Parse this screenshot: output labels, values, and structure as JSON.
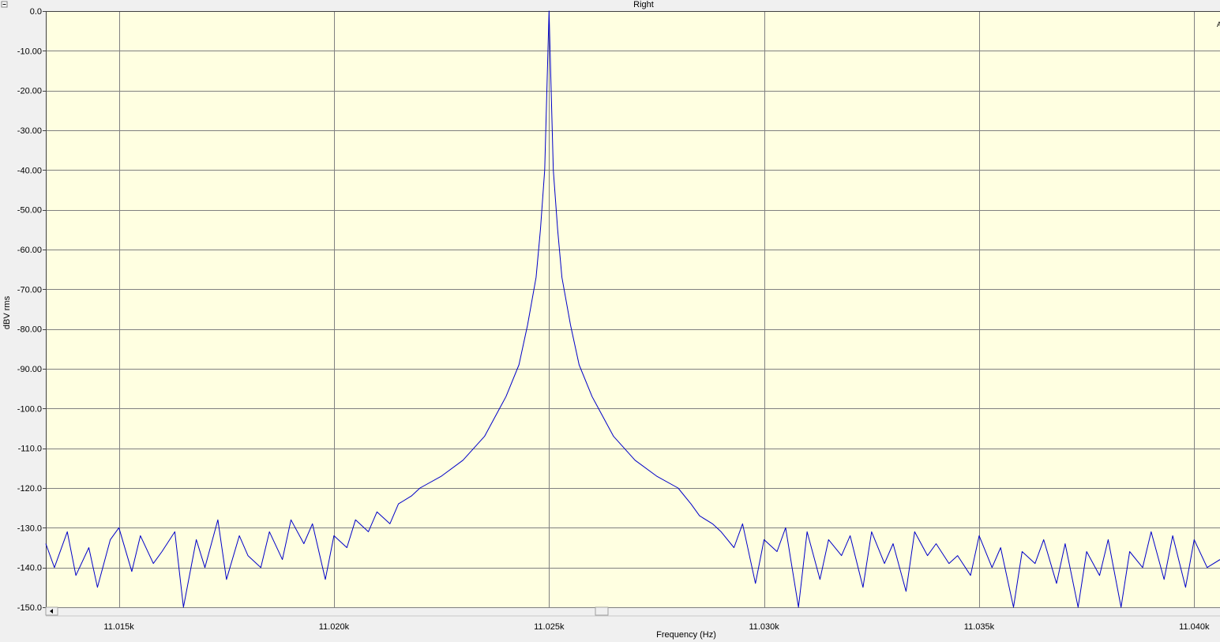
{
  "window": {
    "collapse_icon": "minus-box-icon",
    "corner_label": "A"
  },
  "colors": {
    "plot_background": "#ffffe1",
    "page_background": "#f0f0f0",
    "grid": "#808080",
    "trace": "#0000c8"
  },
  "scrollbar": {
    "left_arrow_icon": "triangle-left-icon",
    "thumb_icon": "scroll-thumb-icon"
  },
  "chart_data": {
    "type": "line",
    "title": "Right",
    "xlabel": "Frequency (Hz)",
    "ylabel": "dBV rms",
    "xlim": [
      11013.3,
      11040.6
    ],
    "ylim": [
      -150,
      0
    ],
    "grid": true,
    "x_ticks": [
      11015,
      11020,
      11025,
      11030,
      11035,
      11040
    ],
    "x_tick_labels": [
      "11.015k",
      "11.020k",
      "11.025k",
      "11.030k",
      "11.035k",
      "11.040k"
    ],
    "y_ticks": [
      0,
      -10,
      -20,
      -30,
      -40,
      -50,
      -60,
      -70,
      -80,
      -90,
      -100,
      -110,
      -120,
      -130,
      -140,
      -150
    ],
    "y_tick_labels": [
      "0.0",
      "-10.00",
      "-20.00",
      "-30.00",
      "-40.00",
      "-50.00",
      "-60.00",
      "-70.00",
      "-80.00",
      "-90.00",
      "-100.0",
      "-110.0",
      "-120.0",
      "-130.0",
      "-140.0",
      "-150.0"
    ],
    "series": [
      {
        "x": [
          11013.3,
          11013.5,
          11013.8,
          11014.0,
          11014.3,
          11014.5,
          11014.8,
          11015.0,
          11015.3,
          11015.5,
          11015.8,
          11016.0,
          11016.3,
          11016.5,
          11016.8,
          11017.0,
          11017.3,
          11017.5,
          11017.8,
          11018.0,
          11018.3,
          11018.5,
          11018.8,
          11019.0,
          11019.3,
          11019.5,
          11019.8,
          11020.0,
          11020.3,
          11020.5,
          11020.8,
          11021.0,
          11021.3,
          11021.5,
          11021.8,
          11022.0,
          11022.5,
          11023.0,
          11023.5,
          11024.0,
          11024.3,
          11024.5,
          11024.7,
          11024.8,
          11024.9,
          11025.0,
          11025.1,
          11025.2,
          11025.3,
          11025.5,
          11025.7,
          11026.0,
          11026.5,
          11027.0,
          11027.5,
          11028.0,
          11028.3,
          11028.5,
          11028.8,
          11029.0,
          11029.3,
          11029.5,
          11029.8,
          11030.0,
          11030.3,
          11030.5,
          11030.8,
          11031.0,
          11031.3,
          11031.5,
          11031.8,
          11032.0,
          11032.3,
          11032.5,
          11032.8,
          11033.0,
          11033.3,
          11033.5,
          11033.8,
          11034.0,
          11034.3,
          11034.5,
          11034.8,
          11035.0,
          11035.3,
          11035.5,
          11035.8,
          11036.0,
          11036.3,
          11036.5,
          11036.8,
          11037.0,
          11037.3,
          11037.5,
          11037.8,
          11038.0,
          11038.3,
          11038.5,
          11038.8,
          11039.0,
          11039.3,
          11039.5,
          11039.8,
          11040.0,
          11040.3,
          11040.6
        ],
        "y": [
          -134,
          -140,
          -131,
          -142,
          -135,
          -145,
          -133,
          -130,
          -141,
          -132,
          -139,
          -136,
          -131,
          -150,
          -133,
          -140,
          -128,
          -143,
          -132,
          -137,
          -140,
          -131,
          -138,
          -128,
          -134,
          -129,
          -143,
          -132,
          -135,
          -128,
          -131,
          -126,
          -129,
          -124,
          -122,
          -120,
          -117,
          -113,
          -107,
          -97,
          -89,
          -79,
          -67,
          -55,
          -40,
          0,
          -40,
          -55,
          -67,
          -79,
          -89,
          -97,
          -107,
          -113,
          -117,
          -120,
          -124,
          -127,
          -129,
          -131,
          -135,
          -129,
          -144,
          -133,
          -136,
          -130,
          -150,
          -131,
          -143,
          -133,
          -137,
          -132,
          -145,
          -131,
          -139,
          -134,
          -146,
          -131,
          -137,
          -134,
          -139,
          -137,
          -142,
          -132,
          -140,
          -135,
          -150,
          -136,
          -139,
          -133,
          -144,
          -134,
          -150,
          -136,
          -142,
          -133,
          -150,
          -136,
          -140,
          -131,
          -143,
          -132,
          -145,
          -133,
          -140,
          -138
        ]
      }
    ]
  }
}
